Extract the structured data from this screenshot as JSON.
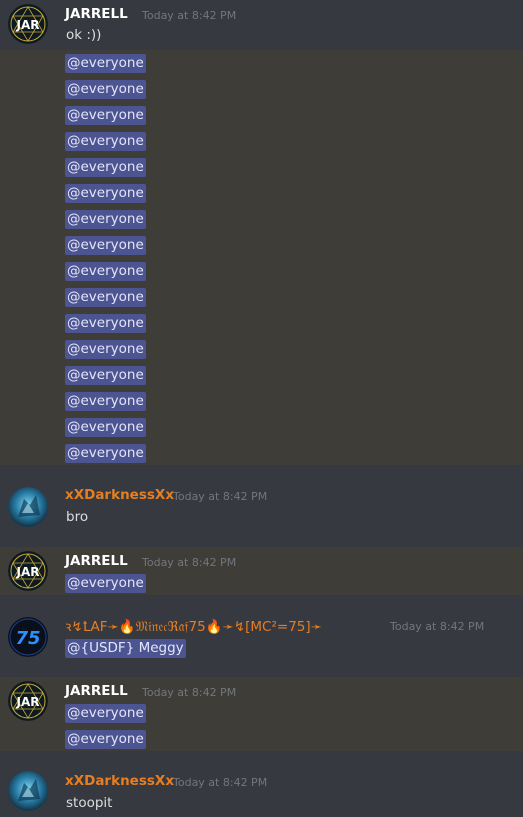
{
  "timestamp": "Today at 8:42 PM",
  "colors": {
    "background": "#36393f",
    "highlight": "#3f3d38",
    "mention_bg": "#4c5492",
    "name_orange": "#e67e22",
    "name_white": "#ffffff"
  },
  "groups": [
    {
      "author": "JARRELL",
      "avatar": "jar-logo-avatar",
      "messages": [
        "ok :))"
      ],
      "mentions": [
        "@everyone",
        "@everyone",
        "@everyone",
        "@everyone",
        "@everyone",
        "@everyone",
        "@everyone",
        "@everyone",
        "@everyone",
        "@everyone",
        "@everyone",
        "@everyone",
        "@everyone",
        "@everyone",
        "@everyone",
        "@everyone"
      ]
    },
    {
      "author": "xXDarknessXx",
      "avatar": "blue-warrior-avatar",
      "messages": [
        "bro"
      ]
    },
    {
      "author": "JARRELL",
      "avatar": "jar-logo-avatar",
      "mentions": [
        "@everyone"
      ]
    },
    {
      "author": "ꝛ↯ꝈΑF➛🔥𝔐𝔦𝔫𝔢𝔠ℜ𝔞𝔣75🔥➛↯[MC²=75]➛",
      "avatar": "75-logo-avatar",
      "avatar_text": "75",
      "mention_role": "@{USDF} Meggy"
    },
    {
      "author": "JARRELL",
      "avatar": "jar-logo-avatar",
      "mentions": [
        "@everyone",
        "@everyone"
      ]
    },
    {
      "author": "xXDarknessXx",
      "avatar": "blue-warrior-avatar",
      "messages": [
        "stoopit"
      ]
    }
  ],
  "jar_logo_text": "JAR"
}
